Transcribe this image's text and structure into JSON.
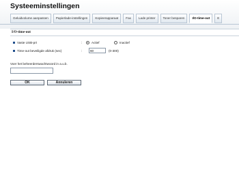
{
  "page_title": "Systeeminstellingen",
  "tabs": [
    {
      "label": "Geluidvolume aanpassen",
      "active": false
    },
    {
      "label": "Papierlade-instellingen",
      "active": false
    },
    {
      "label": "Kopieerapparaat",
      "active": false
    },
    {
      "label": "Fax",
      "active": false
    },
    {
      "label": "Lade printer",
      "active": false
    },
    {
      "label": "Toner besparen",
      "active": false
    },
    {
      "label": "I/O-time-out",
      "active": true
    },
    {
      "label": "E",
      "active": false
    }
  ],
  "section": {
    "title": "I/O-time-out",
    "usb_port": {
      "label": "Vaste USB-prt",
      "separator": ":",
      "options": [
        {
          "label": "Actief",
          "checked": true
        },
        {
          "label": "Inactief",
          "checked": false
        }
      ]
    },
    "timeout": {
      "label": "Time-out beveiligde afdruk (sec)",
      "separator": ":",
      "value": "60",
      "range": "(0-300)"
    }
  },
  "password_prompt": "Voer het beheerderswachtwoord in a.u.b.",
  "password_value": "",
  "buttons": {
    "ok": "OK",
    "cancel": "Annuleren"
  },
  "colors": {
    "accent": "#1f4e8c",
    "tab_border": "#b9c6d4"
  }
}
